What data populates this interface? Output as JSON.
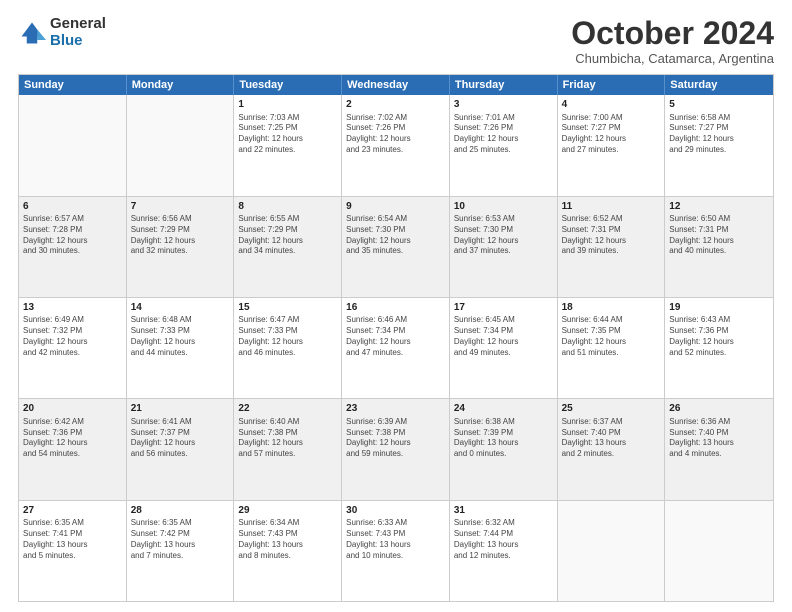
{
  "logo": {
    "general": "General",
    "blue": "Blue"
  },
  "title": "October 2024",
  "subtitle": "Chumbicha, Catamarca, Argentina",
  "header_days": [
    "Sunday",
    "Monday",
    "Tuesday",
    "Wednesday",
    "Thursday",
    "Friday",
    "Saturday"
  ],
  "weeks": [
    [
      {
        "day": "",
        "text": "",
        "empty": true
      },
      {
        "day": "",
        "text": "",
        "empty": true
      },
      {
        "day": "1",
        "text": "Sunrise: 7:03 AM\nSunset: 7:25 PM\nDaylight: 12 hours\nand 22 minutes.",
        "empty": false
      },
      {
        "day": "2",
        "text": "Sunrise: 7:02 AM\nSunset: 7:26 PM\nDaylight: 12 hours\nand 23 minutes.",
        "empty": false
      },
      {
        "day": "3",
        "text": "Sunrise: 7:01 AM\nSunset: 7:26 PM\nDaylight: 12 hours\nand 25 minutes.",
        "empty": false
      },
      {
        "day": "4",
        "text": "Sunrise: 7:00 AM\nSunset: 7:27 PM\nDaylight: 12 hours\nand 27 minutes.",
        "empty": false
      },
      {
        "day": "5",
        "text": "Sunrise: 6:58 AM\nSunset: 7:27 PM\nDaylight: 12 hours\nand 29 minutes.",
        "empty": false
      }
    ],
    [
      {
        "day": "6",
        "text": "Sunrise: 6:57 AM\nSunset: 7:28 PM\nDaylight: 12 hours\nand 30 minutes.",
        "empty": false
      },
      {
        "day": "7",
        "text": "Sunrise: 6:56 AM\nSunset: 7:29 PM\nDaylight: 12 hours\nand 32 minutes.",
        "empty": false
      },
      {
        "day": "8",
        "text": "Sunrise: 6:55 AM\nSunset: 7:29 PM\nDaylight: 12 hours\nand 34 minutes.",
        "empty": false
      },
      {
        "day": "9",
        "text": "Sunrise: 6:54 AM\nSunset: 7:30 PM\nDaylight: 12 hours\nand 35 minutes.",
        "empty": false
      },
      {
        "day": "10",
        "text": "Sunrise: 6:53 AM\nSunset: 7:30 PM\nDaylight: 12 hours\nand 37 minutes.",
        "empty": false
      },
      {
        "day": "11",
        "text": "Sunrise: 6:52 AM\nSunset: 7:31 PM\nDaylight: 12 hours\nand 39 minutes.",
        "empty": false
      },
      {
        "day": "12",
        "text": "Sunrise: 6:50 AM\nSunset: 7:31 PM\nDaylight: 12 hours\nand 40 minutes.",
        "empty": false
      }
    ],
    [
      {
        "day": "13",
        "text": "Sunrise: 6:49 AM\nSunset: 7:32 PM\nDaylight: 12 hours\nand 42 minutes.",
        "empty": false
      },
      {
        "day": "14",
        "text": "Sunrise: 6:48 AM\nSunset: 7:33 PM\nDaylight: 12 hours\nand 44 minutes.",
        "empty": false
      },
      {
        "day": "15",
        "text": "Sunrise: 6:47 AM\nSunset: 7:33 PM\nDaylight: 12 hours\nand 46 minutes.",
        "empty": false
      },
      {
        "day": "16",
        "text": "Sunrise: 6:46 AM\nSunset: 7:34 PM\nDaylight: 12 hours\nand 47 minutes.",
        "empty": false
      },
      {
        "day": "17",
        "text": "Sunrise: 6:45 AM\nSunset: 7:34 PM\nDaylight: 12 hours\nand 49 minutes.",
        "empty": false
      },
      {
        "day": "18",
        "text": "Sunrise: 6:44 AM\nSunset: 7:35 PM\nDaylight: 12 hours\nand 51 minutes.",
        "empty": false
      },
      {
        "day": "19",
        "text": "Sunrise: 6:43 AM\nSunset: 7:36 PM\nDaylight: 12 hours\nand 52 minutes.",
        "empty": false
      }
    ],
    [
      {
        "day": "20",
        "text": "Sunrise: 6:42 AM\nSunset: 7:36 PM\nDaylight: 12 hours\nand 54 minutes.",
        "empty": false
      },
      {
        "day": "21",
        "text": "Sunrise: 6:41 AM\nSunset: 7:37 PM\nDaylight: 12 hours\nand 56 minutes.",
        "empty": false
      },
      {
        "day": "22",
        "text": "Sunrise: 6:40 AM\nSunset: 7:38 PM\nDaylight: 12 hours\nand 57 minutes.",
        "empty": false
      },
      {
        "day": "23",
        "text": "Sunrise: 6:39 AM\nSunset: 7:38 PM\nDaylight: 12 hours\nand 59 minutes.",
        "empty": false
      },
      {
        "day": "24",
        "text": "Sunrise: 6:38 AM\nSunset: 7:39 PM\nDaylight: 13 hours\nand 0 minutes.",
        "empty": false
      },
      {
        "day": "25",
        "text": "Sunrise: 6:37 AM\nSunset: 7:40 PM\nDaylight: 13 hours\nand 2 minutes.",
        "empty": false
      },
      {
        "day": "26",
        "text": "Sunrise: 6:36 AM\nSunset: 7:40 PM\nDaylight: 13 hours\nand 4 minutes.",
        "empty": false
      }
    ],
    [
      {
        "day": "27",
        "text": "Sunrise: 6:35 AM\nSunset: 7:41 PM\nDaylight: 13 hours\nand 5 minutes.",
        "empty": false
      },
      {
        "day": "28",
        "text": "Sunrise: 6:35 AM\nSunset: 7:42 PM\nDaylight: 13 hours\nand 7 minutes.",
        "empty": false
      },
      {
        "day": "29",
        "text": "Sunrise: 6:34 AM\nSunset: 7:43 PM\nDaylight: 13 hours\nand 8 minutes.",
        "empty": false
      },
      {
        "day": "30",
        "text": "Sunrise: 6:33 AM\nSunset: 7:43 PM\nDaylight: 13 hours\nand 10 minutes.",
        "empty": false
      },
      {
        "day": "31",
        "text": "Sunrise: 6:32 AM\nSunset: 7:44 PM\nDaylight: 13 hours\nand 12 minutes.",
        "empty": false
      },
      {
        "day": "",
        "text": "",
        "empty": true
      },
      {
        "day": "",
        "text": "",
        "empty": true
      }
    ]
  ]
}
